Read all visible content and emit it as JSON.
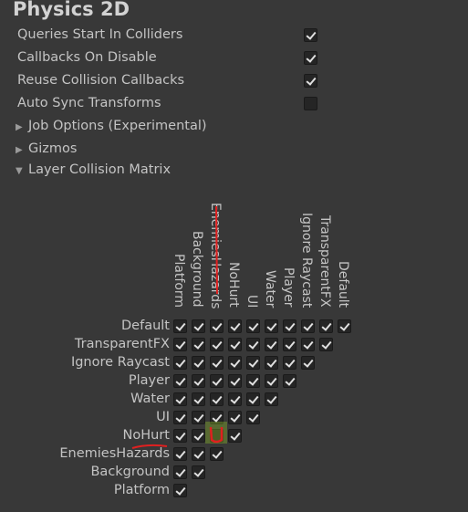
{
  "section": {
    "title": "Physics 2D"
  },
  "settings": [
    {
      "label": "Queries Start In Colliders",
      "checked": true
    },
    {
      "label": "Callbacks On Disable",
      "checked": true
    },
    {
      "label": "Reuse Collision Callbacks",
      "checked": true
    },
    {
      "label": "Auto Sync Transforms",
      "checked": false
    }
  ],
  "foldouts": [
    {
      "label": "Job Options (Experimental)",
      "expanded": false
    },
    {
      "label": "Gizmos",
      "expanded": false
    },
    {
      "label": "Layer Collision Matrix",
      "expanded": true
    }
  ],
  "matrix": {
    "columns": [
      "Platform",
      "Background",
      "EnemiesHazards",
      "NoHurt",
      "UI",
      "Water",
      "Player",
      "Ignore Raycast",
      "TransparentFX",
      "Default"
    ],
    "rows": [
      {
        "label": "Default",
        "cells": [
          true,
          true,
          true,
          true,
          true,
          true,
          true,
          true,
          true,
          true
        ]
      },
      {
        "label": "TransparentFX",
        "cells": [
          true,
          true,
          true,
          true,
          true,
          true,
          true,
          true,
          true
        ]
      },
      {
        "label": "Ignore Raycast",
        "cells": [
          true,
          true,
          true,
          true,
          true,
          true,
          true,
          true
        ]
      },
      {
        "label": "Player",
        "cells": [
          true,
          true,
          true,
          true,
          true,
          true,
          true
        ]
      },
      {
        "label": "Water",
        "cells": [
          true,
          true,
          true,
          true,
          true,
          true
        ]
      },
      {
        "label": "UI",
        "cells": [
          true,
          true,
          true,
          true,
          true
        ]
      },
      {
        "label": "NoHurt",
        "cells": [
          true,
          true,
          false,
          true
        ]
      },
      {
        "label": "EnemiesHazards",
        "cells": [
          true,
          true,
          true
        ]
      },
      {
        "label": "Background",
        "cells": [
          true,
          true
        ]
      },
      {
        "label": "Platform",
        "cells": [
          true
        ]
      }
    ]
  },
  "colors": {
    "background": "#383838",
    "annotation": "#e02020",
    "highlight": "#9acd32"
  }
}
